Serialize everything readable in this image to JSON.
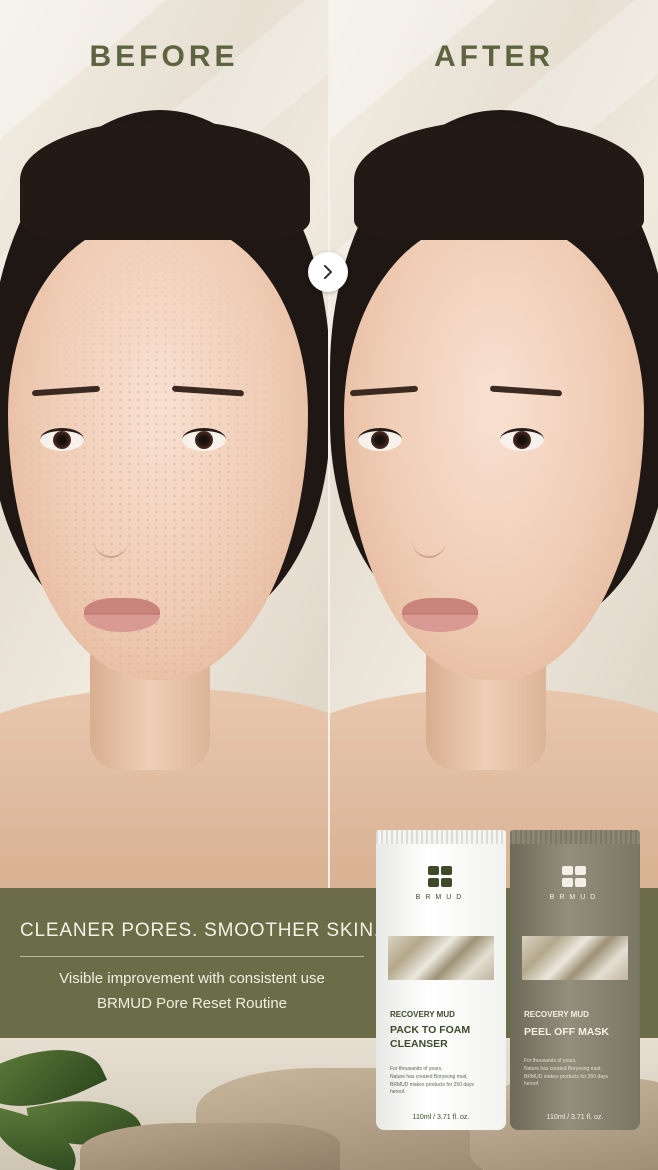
{
  "comparison": {
    "before_label": "BEFORE",
    "after_label": "AFTER",
    "arrow_icon": "chevron-right-icon"
  },
  "banner": {
    "headline": "CLEANER PORES. SMOOTHER SKIN.",
    "subline_1": "Visible improvement with consistent use",
    "subline_2": "BRMUD Pore Reset Routine",
    "background_color": "#6a6d47"
  },
  "products": [
    {
      "brand": "BRMUD",
      "line": "RECOVERY MUD",
      "name_line_1": "PACK TO FOAM",
      "name_line_2": "CLEANSER",
      "description_1": "For thousands of years,",
      "description_2": "Nature has created Boryeong mud.",
      "description_3": "BRMUD makes products for 250 days hereof.",
      "volume": "110ml / 3.71 fl. oz.",
      "tube_color": "#ffffff"
    },
    {
      "brand": "BRMUD",
      "line": "RECOVERY MUD",
      "name_line_1": "PEEL OFF MASK",
      "description_1": "For thousands of years,",
      "description_2": "Nature has created Boryeong mud.",
      "description_3": "BRMUD makes products for 250 days hereof.",
      "volume": "110ml / 3.71 fl. oz.",
      "tube_color": "#8a8674"
    }
  ]
}
